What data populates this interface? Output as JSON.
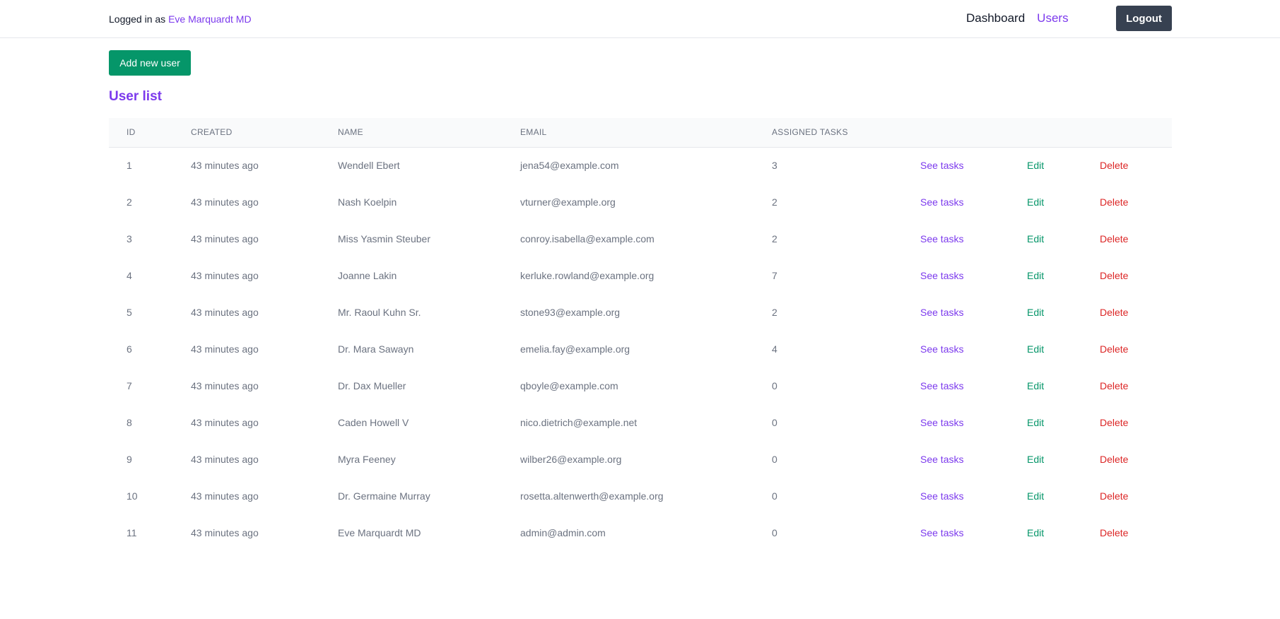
{
  "header": {
    "logged_in_prefix": "Logged in as",
    "user_name": "Eve Marquardt MD",
    "nav": {
      "dashboard": "Dashboard",
      "users": "Users"
    },
    "logout_label": "Logout"
  },
  "toolbar": {
    "add_user_label": "Add new user"
  },
  "section_title": "User list",
  "table": {
    "columns": [
      "ID",
      "Created",
      "Name",
      "Email",
      "Assigned tasks"
    ],
    "actions": {
      "see_tasks": "See tasks",
      "edit": "Edit",
      "delete": "Delete"
    },
    "rows": [
      {
        "id": "1",
        "created": "43 minutes ago",
        "name": "Wendell Ebert",
        "email": "jena54@example.com",
        "tasks": "3"
      },
      {
        "id": "2",
        "created": "43 minutes ago",
        "name": "Nash Koelpin",
        "email": "vturner@example.org",
        "tasks": "2"
      },
      {
        "id": "3",
        "created": "43 minutes ago",
        "name": "Miss Yasmin Steuber",
        "email": "conroy.isabella@example.com",
        "tasks": "2"
      },
      {
        "id": "4",
        "created": "43 minutes ago",
        "name": "Joanne Lakin",
        "email": "kerluke.rowland@example.org",
        "tasks": "7"
      },
      {
        "id": "5",
        "created": "43 minutes ago",
        "name": "Mr. Raoul Kuhn Sr.",
        "email": "stone93@example.org",
        "tasks": "2"
      },
      {
        "id": "6",
        "created": "43 minutes ago",
        "name": "Dr. Mara Sawayn",
        "email": "emelia.fay@example.org",
        "tasks": "4"
      },
      {
        "id": "7",
        "created": "43 minutes ago",
        "name": "Dr. Dax Mueller",
        "email": "qboyle@example.com",
        "tasks": "0"
      },
      {
        "id": "8",
        "created": "43 minutes ago",
        "name": "Caden Howell V",
        "email": "nico.dietrich@example.net",
        "tasks": "0"
      },
      {
        "id": "9",
        "created": "43 minutes ago",
        "name": "Myra Feeney",
        "email": "wilber26@example.org",
        "tasks": "0"
      },
      {
        "id": "10",
        "created": "43 minutes ago",
        "name": "Dr. Germaine Murray",
        "email": "rosetta.altenwerth@example.org",
        "tasks": "0"
      },
      {
        "id": "11",
        "created": "43 minutes ago",
        "name": "Eve Marquardt MD",
        "email": "admin@admin.com",
        "tasks": "0"
      }
    ]
  },
  "colors": {
    "accent": "#7c3aed",
    "success": "#059669",
    "danger": "#dc2626",
    "dark_button": "#374151"
  }
}
